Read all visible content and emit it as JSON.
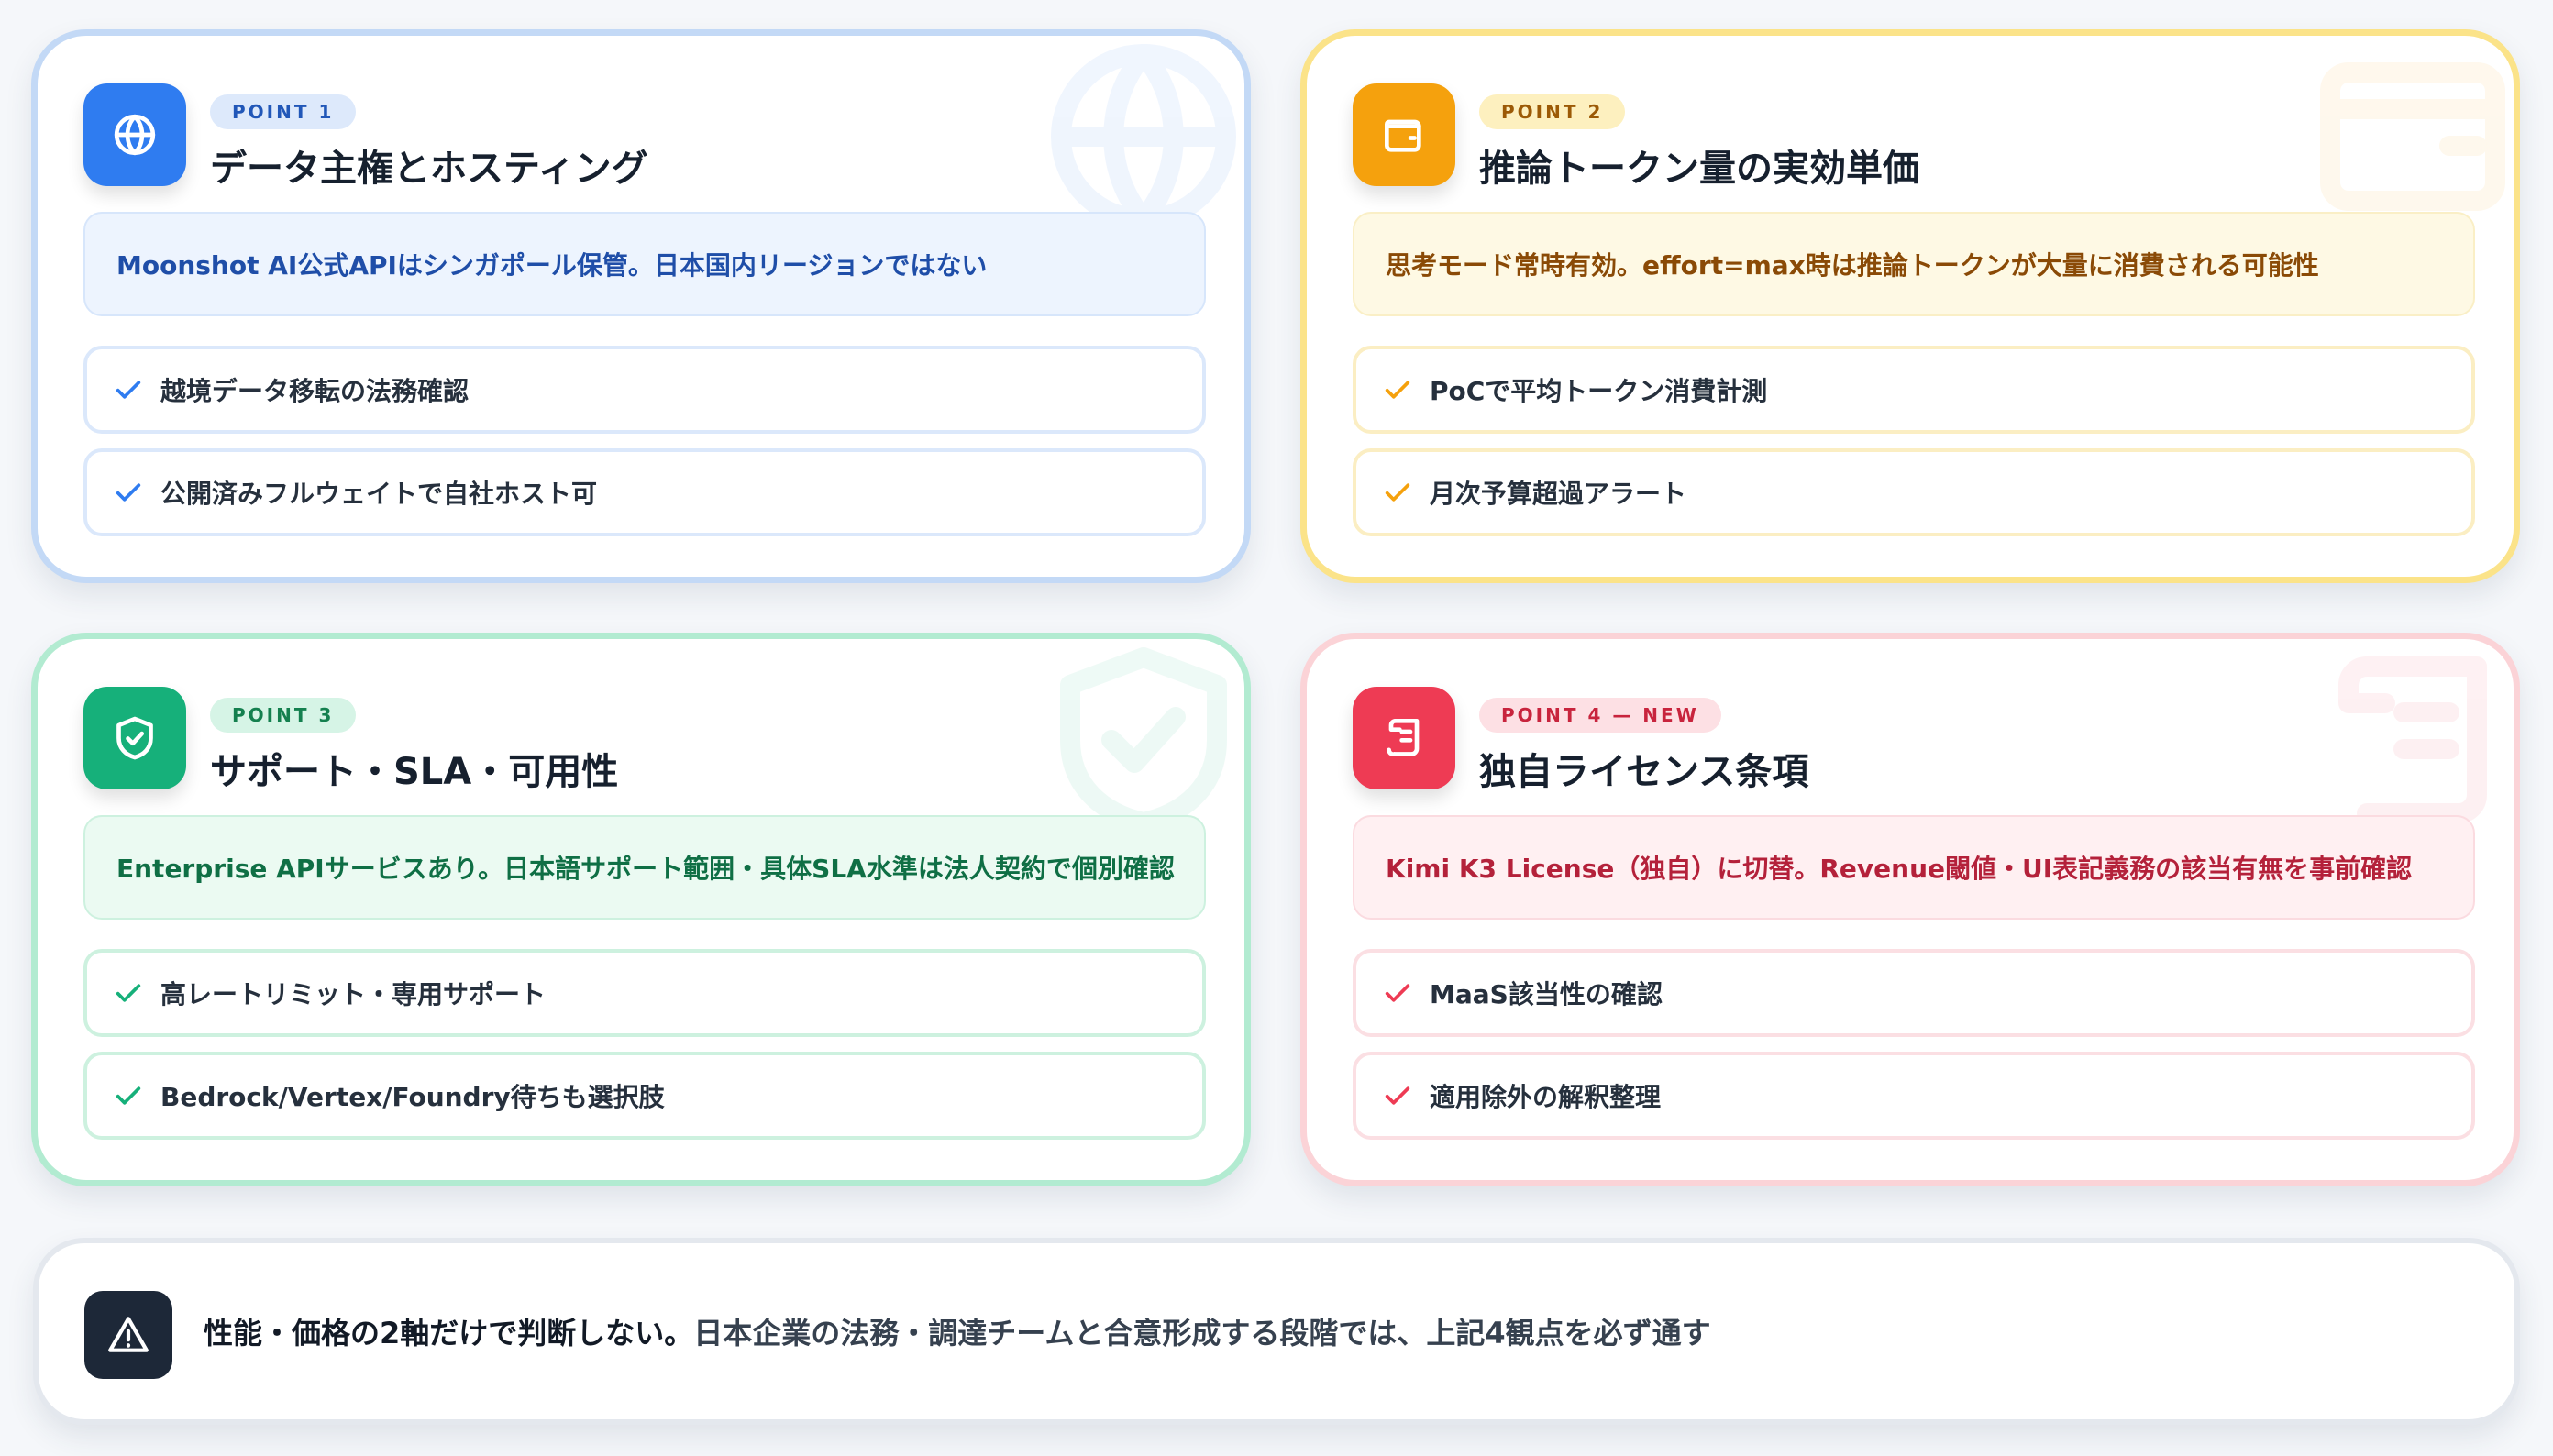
{
  "colors": {
    "point1": "#2f7cf0",
    "point2": "#f5a10d",
    "point3": "#16b07a",
    "point4": "#ee3b54",
    "footer_icon": "#1d2838"
  },
  "cards": [
    {
      "icon": "globe-icon",
      "badge": "POINT 1",
      "title": "データ主権とホスティング",
      "highlight": "Moonshot AI公式APIはシンガポール保管。日本国内リージョンではない",
      "items": [
        "越境データ移転の法務確認",
        "公開済みフルウェイトで自社ホスト可"
      ]
    },
    {
      "icon": "wallet-icon",
      "badge": "POINT 2",
      "title": "推論トークン量の実効単価",
      "highlight": "思考モード常時有効。effort=max時は推論トークンが大量に消費される可能性",
      "items": [
        "PoCで平均トークン消費計測",
        "月次予算超過アラート"
      ]
    },
    {
      "icon": "shield-check-icon",
      "badge": "POINT 3",
      "title": "サポート・SLA・可用性",
      "highlight": "Enterprise APIサービスあり。日本語サポート範囲・具体SLA水準は法人契約で個別確認",
      "items": [
        "高レートリミット・専用サポート",
        "Bedrock/Vertex/Foundry待ちも選択肢"
      ]
    },
    {
      "icon": "license-scroll-icon",
      "badge": "POINT 4 — NEW",
      "title": "独自ライセンス条項",
      "highlight": "Kimi K3 License（独自）に切替。Revenue閾値・UI表記義務の該当有無を事前確認",
      "items": [
        "MaaS該当性の確認",
        "適用除外の解釈整理"
      ]
    }
  ],
  "footer": {
    "icon": "warning-icon",
    "strong": "性能・価格の2軸だけで判断しない。",
    "rest": "日本企業の法務・調達チームと合意形成する段階では、上記4観点を必ず通す"
  }
}
